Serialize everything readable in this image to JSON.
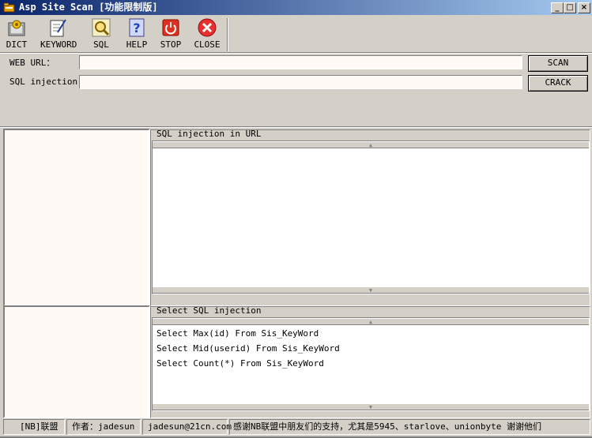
{
  "window": {
    "title": "Asp Site Scan [功能限制版]",
    "controls": {
      "minimize": "_",
      "maximize": "□",
      "close": "×"
    }
  },
  "toolbar": {
    "items": [
      {
        "label": "DICT",
        "icon": "dict-icon"
      },
      {
        "label": "KEYWORD",
        "icon": "keyword-icon"
      },
      {
        "label": "SQL",
        "icon": "sql-icon"
      },
      {
        "label": "HELP",
        "icon": "help-icon"
      },
      {
        "label": "STOP",
        "icon": "stop-icon"
      },
      {
        "label": "CLOSE",
        "icon": "close-icon"
      }
    ]
  },
  "form": {
    "web_url_label": "WEB URL：",
    "web_url_value": "",
    "sql_injection_label": "SQL injection：",
    "sql_injection_value": "",
    "scan_button": "SCAN",
    "crack_button": "CRACK"
  },
  "url_panel": {
    "title": "SQL injection in URL",
    "items": []
  },
  "select_panel": {
    "title": "Select SQL injection",
    "items": [
      "Select Max(id) From Sis_KeyWord",
      "Select Mid(userid) From Sis_KeyWord",
      "Select Count(*) From Sis_KeyWord"
    ]
  },
  "scroll": {
    "up": "▲",
    "down": "▼"
  },
  "statusbar": {
    "group": "[NB]联盟",
    "author": "作者：jadesun",
    "email": "jadesun@21cn.com",
    "thanks": "感谢NB联盟中朋友们的支持，尤其是5945、starlove、unionbyte 谢谢他们"
  },
  "colors": {
    "title_gradient_start": "#0a246a",
    "title_gradient_end": "#a6caf0",
    "face": "#d4d0c8",
    "field_bg": "#fffaf5"
  }
}
